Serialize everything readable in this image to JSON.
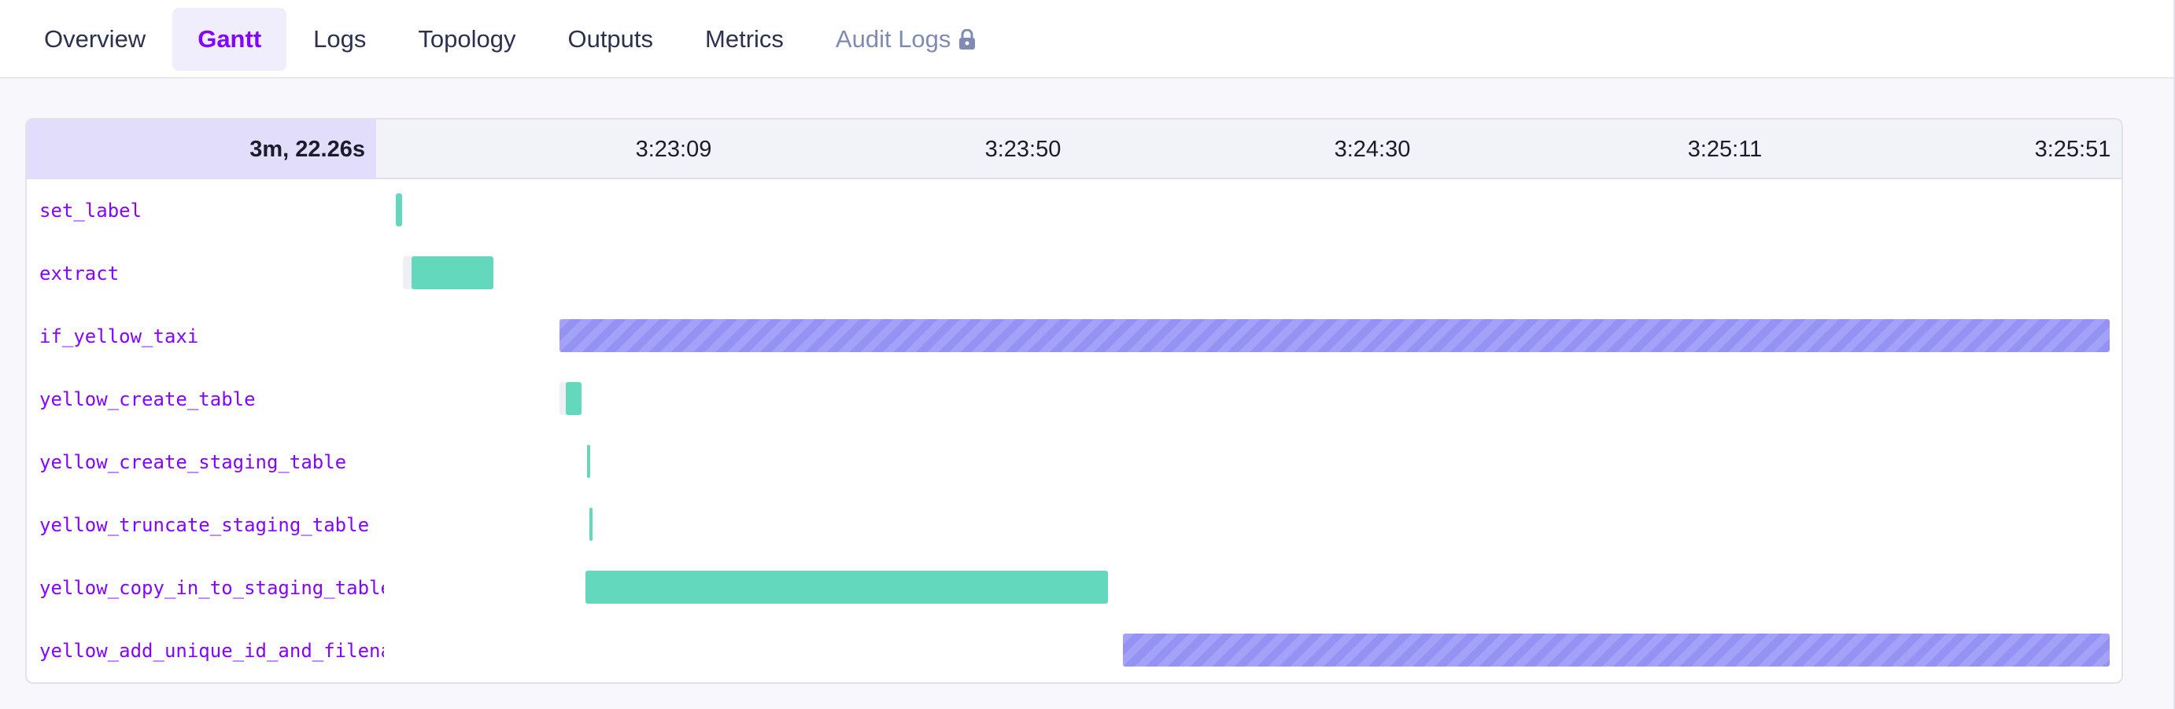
{
  "tabs": [
    {
      "label": "Overview",
      "state": "normal"
    },
    {
      "label": "Gantt",
      "state": "active"
    },
    {
      "label": "Logs",
      "state": "normal"
    },
    {
      "label": "Topology",
      "state": "normal"
    },
    {
      "label": "Outputs",
      "state": "normal"
    },
    {
      "label": "Metrics",
      "state": "normal"
    },
    {
      "label": "Audit Logs",
      "state": "disabled",
      "icon": "lock-icon"
    }
  ],
  "gantt": {
    "total_duration": "3m, 22.26s",
    "ticks": [
      "3:23:09",
      "3:23:50",
      "3:24:30",
      "3:25:11",
      "3:25:51"
    ],
    "tasks": [
      {
        "name": "set_label",
        "state": "success"
      },
      {
        "name": "extract",
        "state": "success"
      },
      {
        "name": "if_yellow_taxi",
        "state": "running"
      },
      {
        "name": "yellow_create_table",
        "state": "success"
      },
      {
        "name": "yellow_create_staging_table",
        "state": "success"
      },
      {
        "name": "yellow_truncate_staging_table",
        "state": "success"
      },
      {
        "name": "yellow_copy_in_to_staging_table",
        "state": "success"
      },
      {
        "name": "yellow_add_unique_id_and_filename",
        "state": "running"
      }
    ]
  },
  "colors": {
    "accent": "#8405ff",
    "success": "#63d8bc",
    "running": "#a3a1f8",
    "duration_bg": "#e1ddfb"
  }
}
